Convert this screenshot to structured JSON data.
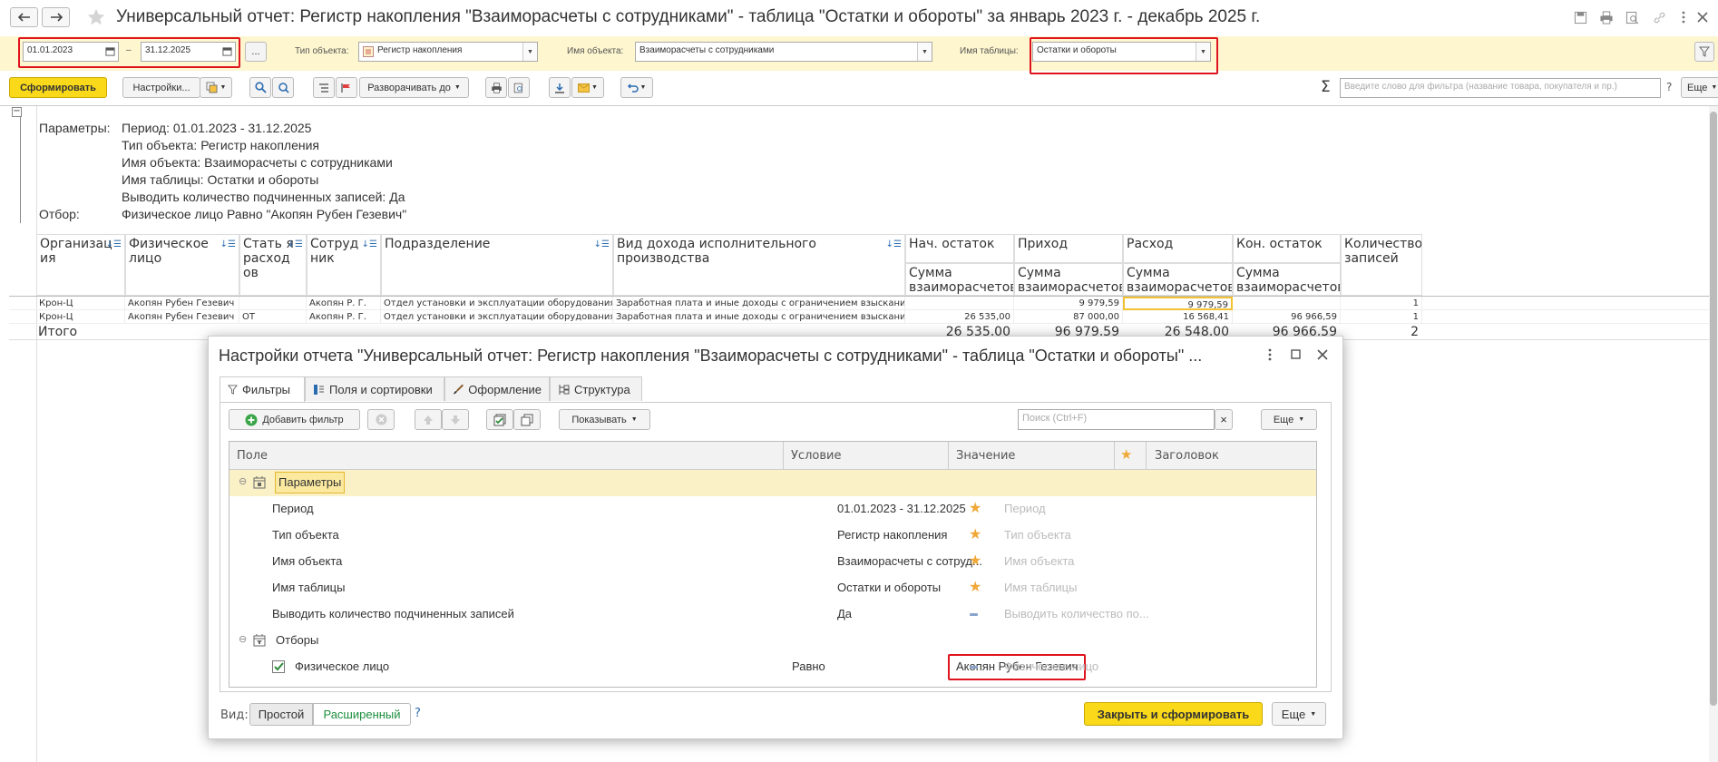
{
  "window": {
    "title": "Универсальный отчет: Регистр накопления \"Взаиморасчеты с сотрудниками\" - таблица \"Остатки и обороты\" за январь 2023 г. - декабрь 2025 г."
  },
  "filters": {
    "date_from": "01.01.2023",
    "date_sep": "–",
    "date_to": "31.12.2025",
    "more": "...",
    "object_type_label": "Тип объекта:",
    "object_type_value": "Регистр накопления",
    "object_name_label": "Имя объекта:",
    "object_name_value": "Взаиморасчеты с сотрудниками",
    "table_name_label": "Имя таблицы:",
    "table_name_value": "Остатки и обороты"
  },
  "toolbar": {
    "form_btn": "Сформировать",
    "settings_btn": "Настройки...",
    "expand_btn": "Разворачивать до",
    "search_placeholder": "Введите слово для фильтра (название товара, покупателя и пр.)",
    "help": "?",
    "more_btn": "Еще",
    "sigma": "Σ"
  },
  "report": {
    "params_label": "Параметры:",
    "params": [
      "Период: 01.01.2023 - 31.12.2025",
      "Тип объекта: Регистр накопления",
      "Имя объекта: Взаиморасчеты с сотрудниками",
      "Имя таблицы: Остатки и обороты",
      "Выводить количество подчиненных записей: Да"
    ],
    "filter_label": "Отбор:",
    "filter_value": "Физическое лицо Равно \"Акопян Рубен Гезевич\"",
    "headers": {
      "org": "Организац ия",
      "person": "Физическое лицо",
      "article": "Стать я расход ов",
      "employee": "Сотруд ник",
      "dept": "Подразделение",
      "income": "Вид дохода исполнительного производства",
      "start": "Нач. остаток",
      "in": "Приход",
      "out": "Расход",
      "end": "Кон. остаток",
      "count": "Количество записей",
      "sub": "Сумма взаиморасчетов"
    },
    "rows": [
      {
        "org": "Крон-Ц",
        "person": "Акопян Рубен Гезевич",
        "article": "",
        "employee": "Акопян Р. Г.",
        "dept": "Отдел установки и эксплуатации оборудования",
        "income": "Заработная плата и иные доходы с ограничением взыскания",
        "start": "",
        "in": "9 979,59",
        "out": "9 979,59",
        "end": "",
        "count": "1"
      },
      {
        "org": "Крон-Ц",
        "person": "Акопян Рубен Гезевич",
        "article": "ОТ",
        "employee": "Акопян Р. Г.",
        "dept": "Отдел установки и эксплуатации оборудования",
        "income": "Заработная плата и иные доходы с ограничением взыскания",
        "start": "26 535,00",
        "in": "87 000,00",
        "out": "16 568,41",
        "end": "96 966,59",
        "count": "1"
      }
    ],
    "total": {
      "label": "Итого",
      "start": "26 535,00",
      "in": "96 979,59",
      "out": "26 548,00",
      "end": "96 966,59",
      "count": "2"
    }
  },
  "dialog": {
    "title": "Настройки отчета \"Универсальный отчет: Регистр накопления \"Взаиморасчеты с сотрудниками\" - таблица \"Остатки и обороты\" ...",
    "tabs": [
      "Фильтры",
      "Поля и сортировки",
      "Оформление",
      "Структура"
    ],
    "add_filter": "Добавить фильтр",
    "show_btn": "Показывать",
    "search_placeholder": "Поиск (Ctrl+F)",
    "search_clear": "×",
    "more_btn": "Еще",
    "columns": {
      "field": "Поле",
      "condition": "Условие",
      "value": "Значение",
      "header": "Заголовок"
    },
    "group_params": "Параметры",
    "rows": [
      {
        "field": "Период",
        "value": "01.01.2023 - 31.12.2025",
        "header": "Период",
        "mark": "star"
      },
      {
        "field": "Тип объекта",
        "value": "Регистр накопления",
        "header": "Тип объекта",
        "mark": "star"
      },
      {
        "field": "Имя объекта",
        "value": "Взаиморасчеты с сотруд...",
        "header": "Имя объекта",
        "mark": "star"
      },
      {
        "field": "Имя таблицы",
        "value": "Остатки и обороты",
        "header": "Имя таблицы",
        "mark": "star"
      },
      {
        "field": "Выводить количество подчиненных записей",
        "value": "Да",
        "header": "Выводить количество по...",
        "mark": "dash"
      }
    ],
    "group_filters": "Отборы",
    "filter_row": {
      "field": "Физическое лицо",
      "condition": "Равно",
      "value": "Акопян Рубен Гезевич",
      "header": "Физическое лицо"
    },
    "view_label": "Вид:",
    "view_simple": "Простой",
    "view_extended": "Расширенный",
    "help": "?",
    "close_form": "Закрыть и сформировать",
    "bottom_more": "Еще"
  }
}
